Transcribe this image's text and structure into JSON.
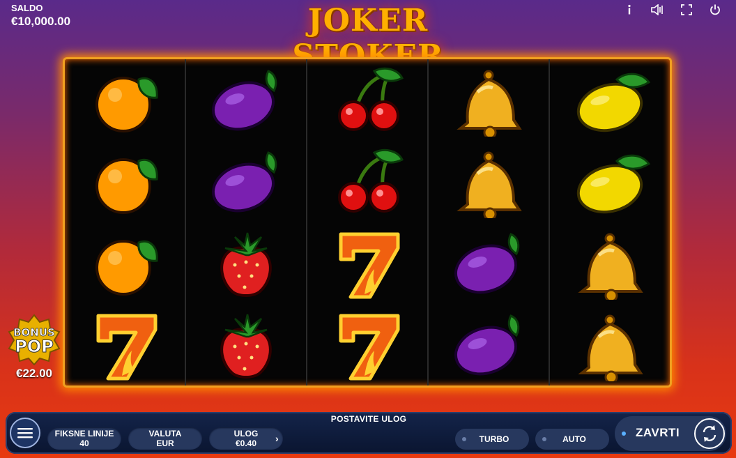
{
  "header": {
    "balance_label": "SALDO",
    "balance_value": "€10,000.00",
    "logo": "JOKER STOKER"
  },
  "top_icons": [
    "info-icon",
    "sound-icon",
    "fullscreen-icon",
    "power-icon"
  ],
  "reels": [
    [
      "orange",
      "orange",
      "orange",
      "seven"
    ],
    [
      "plum",
      "plum",
      "strawberry",
      "strawberry"
    ],
    [
      "cherry",
      "cherry",
      "seven",
      "seven"
    ],
    [
      "bell",
      "bell",
      "plum",
      "plum"
    ],
    [
      "lemon",
      "lemon",
      "bell",
      "bell"
    ]
  ],
  "bonus": {
    "line1": "BONUS",
    "line2": "POP",
    "value": "€22.00"
  },
  "bottom": {
    "prompt": "POSTAVITE ULOG",
    "lines_label": "FIKSNE LINIJE",
    "lines_value": "40",
    "currency_label": "VALUTA",
    "currency_value": "EUR",
    "bet_label": "ULOG",
    "bet_value": "€0.40",
    "turbo_label": "TURBO",
    "auto_label": "AUTO",
    "spin_label": "ZAVRTI"
  },
  "colors": {
    "frame": "#f0a020",
    "bar": "#14244a",
    "pill": "#27385e"
  }
}
